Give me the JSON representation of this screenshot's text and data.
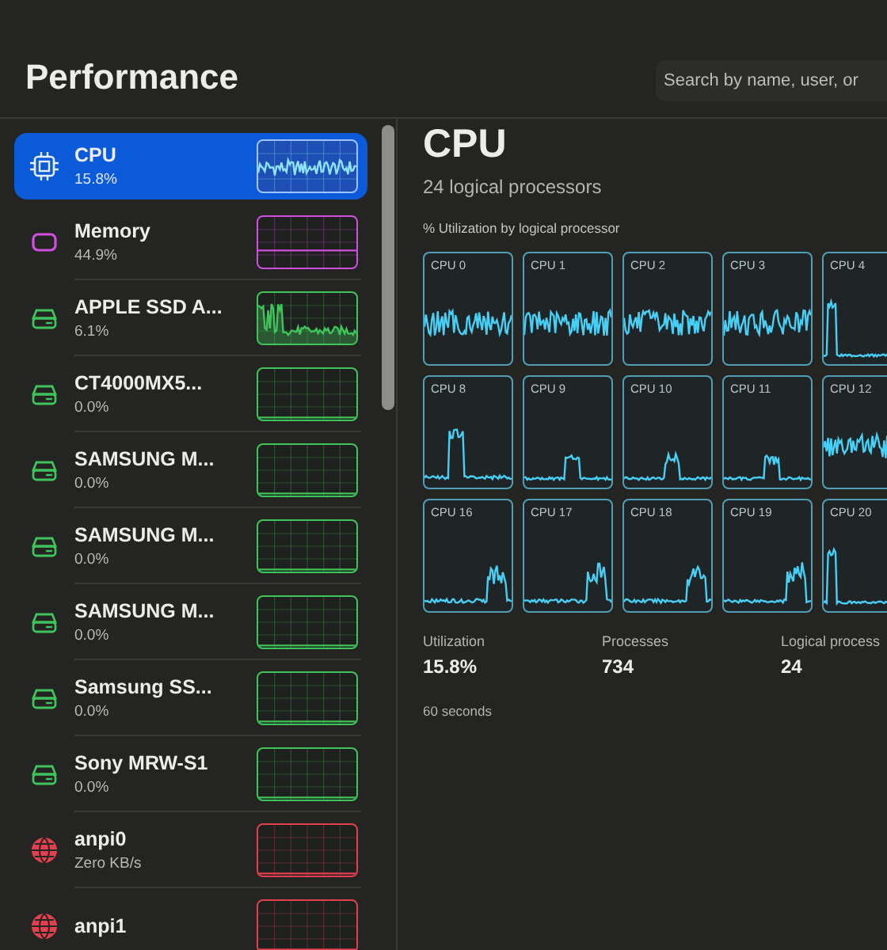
{
  "header": {
    "title": "Performance",
    "search": {
      "placeholder": "Search by name, user, or"
    }
  },
  "sidebar": {
    "items": [
      {
        "kind": "cpu",
        "name": "CPU",
        "value": "15.8%",
        "selected": true
      },
      {
        "kind": "memory",
        "name": "Memory",
        "value": "44.9%",
        "selected": false
      },
      {
        "kind": "disk",
        "name": "APPLE SSD A...",
        "value": "6.1%",
        "selected": false
      },
      {
        "kind": "disk",
        "name": "CT4000MX5...",
        "value": "0.0%",
        "selected": false
      },
      {
        "kind": "disk",
        "name": "SAMSUNG M...",
        "value": "0.0%",
        "selected": false
      },
      {
        "kind": "disk",
        "name": "SAMSUNG M...",
        "value": "0.0%",
        "selected": false
      },
      {
        "kind": "disk",
        "name": "SAMSUNG M...",
        "value": "0.0%",
        "selected": false
      },
      {
        "kind": "disk",
        "name": "Samsung SS...",
        "value": "0.0%",
        "selected": false
      },
      {
        "kind": "disk",
        "name": "Sony MRW-S1",
        "value": "0.0%",
        "selected": false
      },
      {
        "kind": "network",
        "name": "anpi0",
        "value": "Zero KB/s",
        "selected": false
      },
      {
        "kind": "network",
        "name": "anpi1",
        "selected": false
      }
    ]
  },
  "detail": {
    "title": "CPU",
    "subtitle": "24 logical processors",
    "caption": "% Utilization by logical processor",
    "cpu_graphs": [
      {
        "label": "CPU 0"
      },
      {
        "label": "CPU 1"
      },
      {
        "label": "CPU 2"
      },
      {
        "label": "CPU 3"
      },
      {
        "label": "CPU 4"
      },
      {
        "label": "CPU 8"
      },
      {
        "label": "CPU 9"
      },
      {
        "label": "CPU 10"
      },
      {
        "label": "CPU 11"
      },
      {
        "label": "CPU 12"
      },
      {
        "label": "CPU 16"
      },
      {
        "label": "CPU 17"
      },
      {
        "label": "CPU 18"
      },
      {
        "label": "CPU 19"
      },
      {
        "label": "CPU 20"
      }
    ],
    "stats": [
      {
        "label": "Utilization",
        "value": "15.8%"
      },
      {
        "label": "Processes",
        "value": "734"
      },
      {
        "label": "Logical process",
        "value": "24"
      }
    ],
    "footnote": "60 seconds"
  }
}
